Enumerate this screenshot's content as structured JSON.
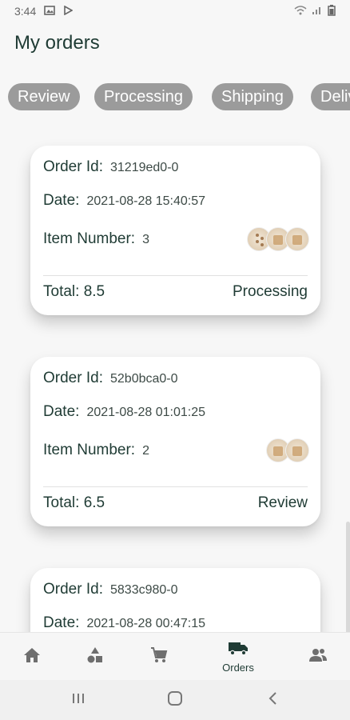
{
  "status_bar": {
    "time": "3:44"
  },
  "header": {
    "title": "My orders"
  },
  "filters": [
    {
      "label": "Review"
    },
    {
      "label": "Processing"
    },
    {
      "label": "Shipping"
    },
    {
      "label": "Deliv"
    }
  ],
  "labels": {
    "order_id": "Order Id:",
    "date": "Date:",
    "item_number": "Item Number:",
    "total": "Total:"
  },
  "orders": [
    {
      "order_id": "31219ed0-0",
      "date": "2021-08-28 15:40:57",
      "item_number": "3",
      "total": "8.5",
      "status": "Processing"
    },
    {
      "order_id": "52b0bca0-0",
      "date": "2021-08-28 01:01:25",
      "item_number": "2",
      "total": "6.5",
      "status": "Review"
    },
    {
      "order_id": "5833c980-0",
      "date": "2021-08-28 00:47:15",
      "item_number": "",
      "total": "",
      "status": ""
    }
  ],
  "bottom_nav": {
    "items": [
      {
        "icon": "home-icon"
      },
      {
        "icon": "categories-icon"
      },
      {
        "icon": "cart-icon"
      },
      {
        "icon": "truck-icon",
        "label": "Orders",
        "active": true
      },
      {
        "icon": "people-icon"
      }
    ]
  },
  "colors": {
    "accent": "#1f3b34",
    "chip_bg": "#9b9b9b",
    "page_bg": "#f7f7f7"
  }
}
